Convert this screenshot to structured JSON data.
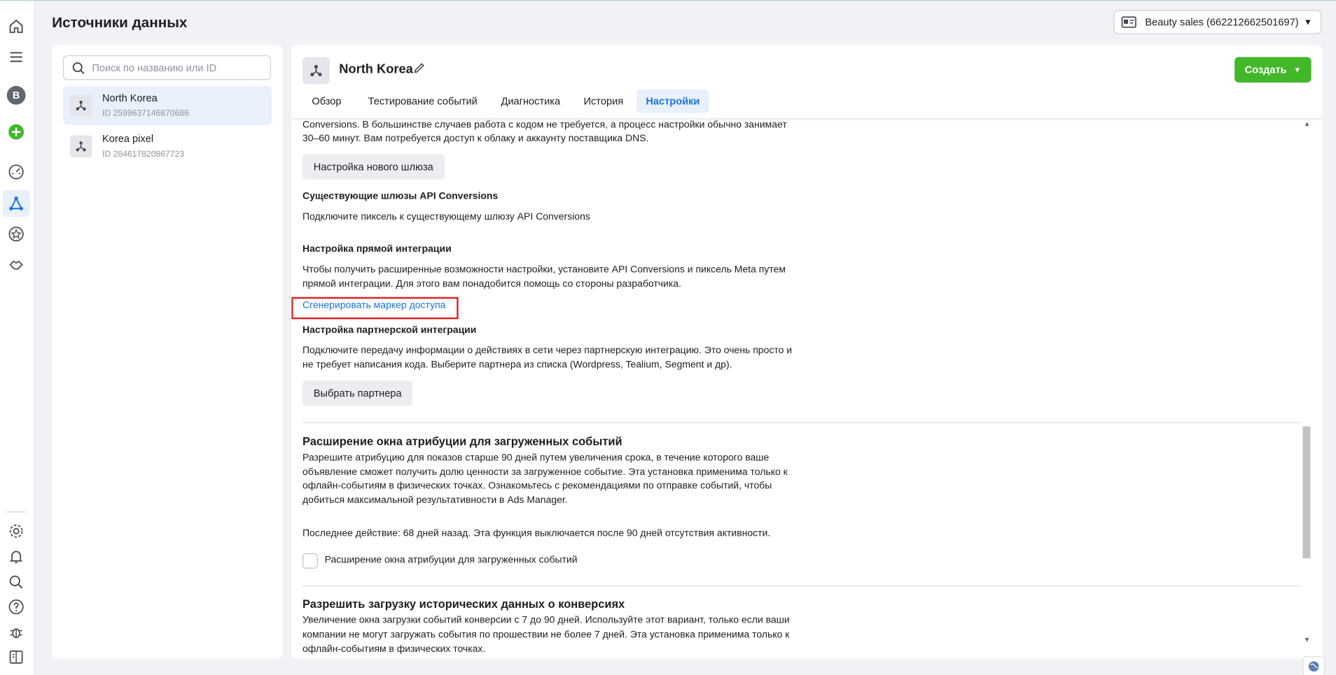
{
  "header": {
    "title": "Источники данных",
    "account_label": "Beauty sales (662212662501697)"
  },
  "sidebar": {
    "avatar_letter": "B",
    "search_placeholder": "Поиск по названию или ID",
    "sources": [
      {
        "name": "North Korea",
        "id": "ID 2599637146870686"
      },
      {
        "name": "Korea pixel",
        "id": "ID 284617820867723"
      }
    ]
  },
  "pixel": {
    "name": "North Korea",
    "create_label": "Создать"
  },
  "tabs": [
    "Обзор",
    "Тестирование событий",
    "Диагностика",
    "История",
    "Настройки"
  ],
  "content": {
    "intro_line1": "Conversions. В большинстве случаев работа с кодом не требуется, а процесс настройки обычно занимает",
    "intro_line2": "30–60 минут. Вам потребуется доступ к облаку и аккаунту поставщика DNS.",
    "new_gateway_btn": "Настройка нового шлюза",
    "existing_title": "Существующие шлюзы API Conversions",
    "existing_text": "Подключите пиксель к существующему шлюзу API Conversions",
    "direct_title": "Настройка прямой интеграции",
    "direct_line1": "Чтобы получить расширенные возможности настройки, установите API Conversions и пиксель Meta путем",
    "direct_line2": "прямой интеграции. Для этого вам понадобится помощь со стороны разработчика.",
    "generate_link": "Сгенерировать маркер доступа",
    "partner_title": "Настройка партнерской интеграции",
    "partner_line1": "Подключите передачу информации о действиях в сети через партнерскую интеграцию. Это очень просто и",
    "partner_line2": "не требует написания кода. Выберите партнера из списка (Wordpress, Tealium, Segment и др).",
    "partner_btn": "Выбрать партнера",
    "attr_title": "Расширение окна атрибуции для загруженных событий",
    "attr_line1": "Разрешите атрибуцию для показов старше 90 дней путем увеличения срока, в течение которого ваше",
    "attr_line2": "объявление сможет получить долю ценности за загруженное событие. Эта установка применима только к",
    "attr_line3": "офлайн-событиям в физических точках. Ознакомьтесь с рекомендациями по отправке событий, чтобы",
    "attr_line4": "добиться максимальной результативности в Ads Manager.",
    "attr_last_action": "Последнее действие: 68 дней назад. Эта функция выключается после 90 дней отсутствия активности.",
    "attr_checkbox_label": "Расширение окна атрибуции для загруженных событий",
    "hist_title": "Разрешить загрузку исторических данных о конверсиях",
    "hist_line1": "Увеличение окна загрузки событий конверсии с 7 до 90 дней. Используйте этот вариант, только если ваши",
    "hist_line2": "компании не могут загружать события по прошествии не более 7 дней. Эта установка применима только к",
    "hist_line3": "офлайн-событиям в физических точках."
  },
  "colors": {
    "accent": "#1b74e4",
    "create_button": "#42b72a",
    "highlight": "#e02020"
  }
}
